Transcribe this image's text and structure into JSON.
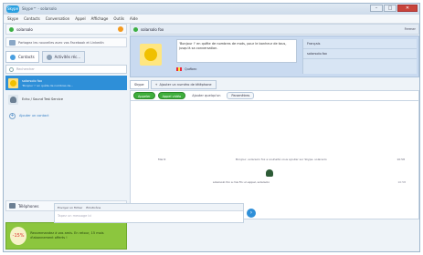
{
  "window": {
    "logo_text": "Skype",
    "title": "Skype™ - solarsolo",
    "minimize": "–",
    "maximize": "□",
    "close": "✕"
  },
  "menu": [
    "Skype",
    "Contacts",
    "Conversation",
    "Appel",
    "Affichage",
    "Outils",
    "Aide"
  ],
  "left": {
    "status_name": "solarsolo",
    "share_label": "Partagez les nouvelles avec vos Facebook et LinkedIn",
    "tabs": {
      "contacts": "Contacts",
      "recent": "Activités réc..."
    },
    "search_placeholder": "Rechercher",
    "contacts": [
      {
        "name": "solarsolo fox",
        "sub": "'Bonjour !' en quête de nombres de..."
      },
      {
        "name": "Echo / Sound Test Service",
        "sub": ""
      }
    ],
    "add_contact": "Ajouter un contact",
    "phones_label": "Téléphones",
    "promo": {
      "badge": "-15%",
      "text": "Recommandez à vos amis. En retour, 15 mois d'abonnement offerts !"
    }
  },
  "right": {
    "contact_name": "solarsolo fox",
    "close_link": "Fermer",
    "mood": "'Bonjour !' en quête de nombres de mots, pour le bonheur de tous, jusqu'à sa conversation.",
    "country": "Québec",
    "side_info": [
      "Français",
      "solarsolo.fox"
    ],
    "chat_tabs": [
      "Skype",
      "Ajouter un numéro de téléphone"
    ],
    "actions": {
      "call": "Appeler",
      "video_call": "Appel vidéo",
      "add_people": "Ajouter quelqu'un",
      "params": "Paramètres"
    },
    "history": {
      "date": "Mardi",
      "message": "Bonjour, solarsolo fox a souhaité vous ajouter sur Skype. solarsolo",
      "time1": "10:58",
      "call_line": "solarsolo fox a mis fin un appel, solarsolo",
      "time2": "10:58"
    },
    "composer": {
      "bar": [
        "Envoyer un fichier",
        "Émoticône"
      ],
      "placeholder": "Tapez un message ici"
    }
  }
}
